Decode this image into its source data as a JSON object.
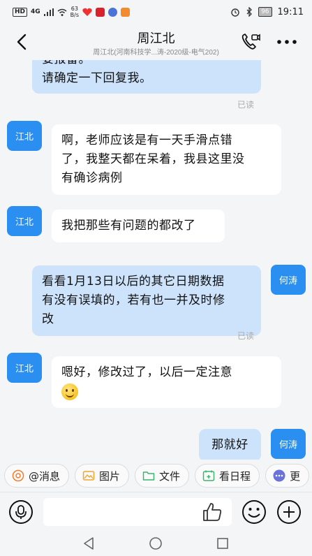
{
  "status_bar": {
    "hd": "HD",
    "signal": "4G",
    "speed_value": "63",
    "speed_unit": "B/s",
    "battery": "96",
    "time": "19:11"
  },
  "header": {
    "title": "周江北",
    "subtitle": "周江北(河南科技学...涛-2020级-电气202)"
  },
  "messages": [
    {
      "side": "out",
      "line1": "委报备。",
      "line2": "请确定一下回复我。",
      "read": "已读"
    },
    {
      "side": "in",
      "avatar": "江北",
      "line1": "啊，老师应该是有一天手滑点错",
      "line2": "了，我整天都在呆着，我县这里没",
      "line3": "有确诊病例"
    },
    {
      "side": "in",
      "avatar": "江北",
      "line1": "我把那些有问题的都改了"
    },
    {
      "side": "out",
      "avatar": "何涛",
      "line1": "看看1月13日以后的其它日期数据",
      "line2": "有没有误填的，若有也一并及时修",
      "line3": "改",
      "read": "已读"
    },
    {
      "side": "in",
      "avatar": "江北",
      "line1": "嗯好，修改过了，以后一定注意"
    },
    {
      "side": "out",
      "avatar": "何涛",
      "line1": "那就好"
    }
  ],
  "quick_actions": [
    "@消息",
    "图片",
    "文件",
    "看日程",
    "更"
  ],
  "colors": {
    "accent": "#2a8ff0",
    "out_bubble": "#cde3fb",
    "in_bubble": "#ffffff",
    "background": "#f4f5f7"
  },
  "icons": {
    "back": "back-arrow-icon",
    "call": "video-call-icon",
    "more": "more-dots-icon",
    "voice": "voice-icon",
    "like": "thumbs-up-icon",
    "emoji": "emoji-icon",
    "plus": "plus-icon"
  }
}
